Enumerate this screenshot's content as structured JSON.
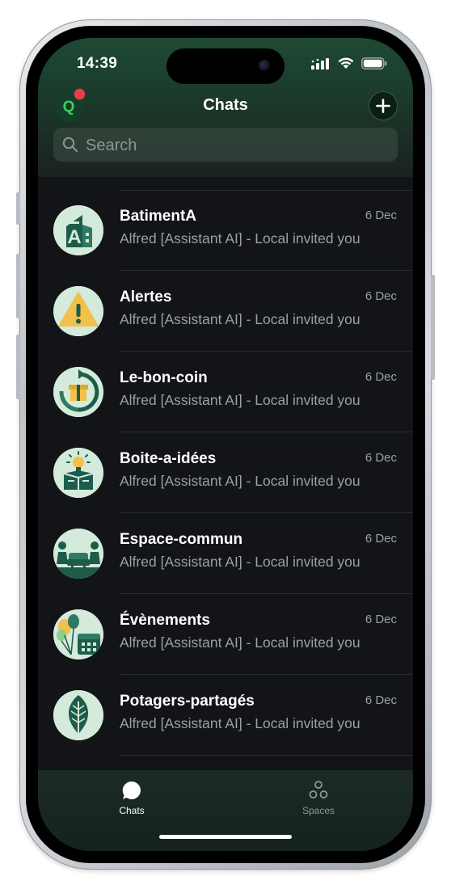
{
  "status_bar": {
    "time": "14:39"
  },
  "header": {
    "avatar_initial": "Q",
    "title": "Chats",
    "search_placeholder": "Search"
  },
  "chats": [
    {
      "name": "BatimentA",
      "preview": "Alfred [Assistant AI] - Local invited you",
      "date": "6 Dec",
      "icon": "building-a-icon"
    },
    {
      "name": "Alertes",
      "preview": "Alfred [Assistant AI] - Local invited you",
      "date": "6 Dec",
      "icon": "warning-icon"
    },
    {
      "name": "Le-bon-coin",
      "preview": "Alfred [Assistant AI] - Local invited you",
      "date": "6 Dec",
      "icon": "gift-exchange-icon"
    },
    {
      "name": "Boite-a-idées",
      "preview": "Alfred [Assistant AI] - Local invited you",
      "date": "6 Dec",
      "icon": "idea-box-icon"
    },
    {
      "name": "Espace-commun",
      "preview": "Alfred [Assistant AI] - Local invited you",
      "date": "6 Dec",
      "icon": "lounge-icon"
    },
    {
      "name": "Évènements",
      "preview": "Alfred [Assistant AI] - Local invited you",
      "date": "6 Dec",
      "icon": "balloons-calendar-icon"
    },
    {
      "name": "Potagers-partagés",
      "preview": "Alfred [Assistant AI] - Local invited you",
      "date": "6 Dec",
      "icon": "leaf-icon"
    }
  ],
  "tab_bar": {
    "tabs": [
      {
        "label": "Chats",
        "icon": "chat-bubble-icon",
        "active": true
      },
      {
        "label": "Spaces",
        "icon": "spaces-icon",
        "active": false
      }
    ]
  },
  "colors": {
    "accent": "#40d05a",
    "header_green": "#1e4a35",
    "background": "#121417",
    "notification": "#ef3b46"
  }
}
